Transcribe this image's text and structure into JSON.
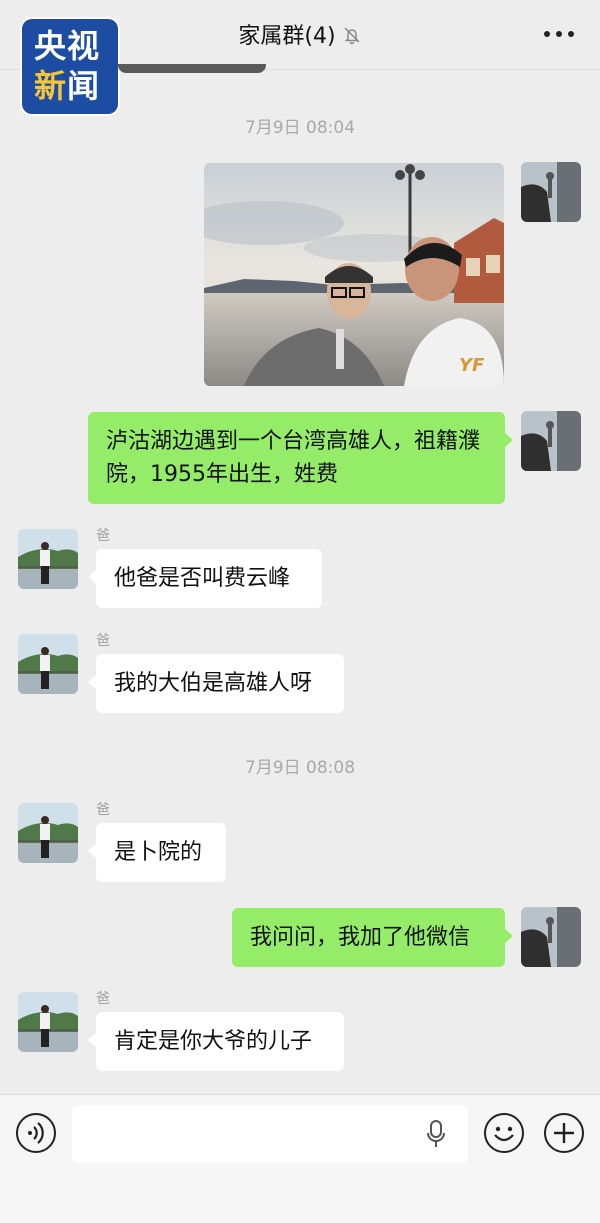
{
  "header": {
    "title": "家属群(4)",
    "mute_icon": "bell-off-icon",
    "more_icon": "more-dots-icon"
  },
  "logo": {
    "line1": "央视",
    "line2_a": "新",
    "line2_b": "闻"
  },
  "messages": {
    "time1": "7月9日 08:04",
    "msg1_text": "泸沽湖边遇到一个台湾高雄人，祖籍濮院，1955年出生，姓费",
    "dad_name": "爸",
    "msg2_text": "他爸是否叫费云峰",
    "msg3_text": "我的大伯是高雄人呀",
    "time2": "7月9日 08:08",
    "msg4_text": "是卜院的",
    "msg5_text": "我问问，我加了他微信",
    "msg6_text": "肯定是你大爷的儿子"
  },
  "input": {
    "voice_icon": "voice-icon",
    "mic_icon": "microphone-icon",
    "emoji_icon": "emoji-icon",
    "plus_icon": "plus-icon"
  },
  "colors": {
    "background": "#ededed",
    "outgoing_bubble": "#95ec69",
    "incoming_bubble": "#ffffff",
    "logo_blue": "#1d4da3"
  }
}
